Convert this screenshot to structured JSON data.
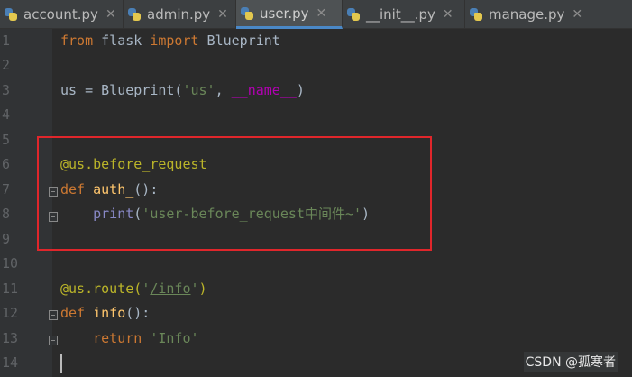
{
  "tabs": [
    {
      "label": "account.py",
      "active": false
    },
    {
      "label": "admin.py",
      "active": false
    },
    {
      "label": "user.py",
      "active": true
    },
    {
      "label": "__init__.py",
      "active": false
    },
    {
      "label": "manage.py",
      "active": false
    }
  ],
  "close_glyph": "✕",
  "line_numbers": [
    "1",
    "2",
    "3",
    "4",
    "5",
    "6",
    "7",
    "8",
    "9",
    "10",
    "11",
    "12",
    "13",
    "14"
  ],
  "code": {
    "l1": {
      "from": "from",
      "mid": " flask ",
      "import": "import",
      "name": " Blueprint"
    },
    "l3": {
      "a": "us = Blueprint(",
      "str": "'us'",
      "b": ", ",
      "dunder": "__name__",
      "c": ")"
    },
    "l6": {
      "dec": "@us.before_request"
    },
    "l7": {
      "def": "def",
      "name": " auth_",
      "rest": "():"
    },
    "l8": {
      "indent": "    ",
      "fn": "print",
      "open": "(",
      "str1": "'user-before_request",
      "cjk": "中间件",
      "str2": "~'",
      "close": ")"
    },
    "l11": {
      "dec": "@us.route(",
      "str1": "'",
      "path": "/info",
      "str2": "'",
      "close": ")"
    },
    "l12": {
      "def": "def",
      "name": " info",
      "rest": "():"
    },
    "l13": {
      "indent": "    ",
      "ret": "return",
      "sp": " ",
      "str": "'Info'"
    }
  },
  "watermark": "CSDN @孤寒者",
  "colors": {
    "keyword": "#cc7832",
    "string": "#6a8759",
    "decorator": "#bbb529",
    "highlight_box": "#e0262b"
  }
}
